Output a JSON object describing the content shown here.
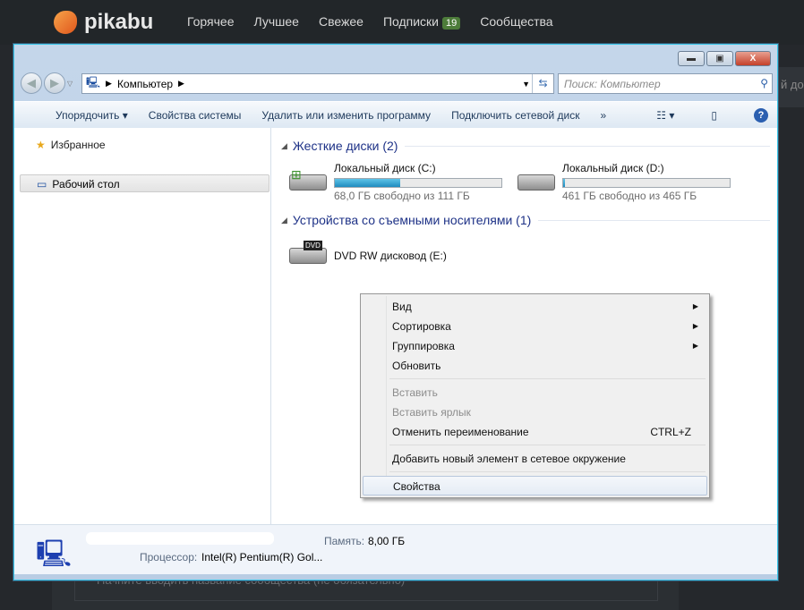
{
  "site": {
    "logo": "pikabu",
    "nav": [
      {
        "label": "Горячее"
      },
      {
        "label": "Лучшее"
      },
      {
        "label": "Свежее"
      },
      {
        "label": "Подписки",
        "badge": "19"
      },
      {
        "label": "Сообщества"
      }
    ],
    "side_text": "й до",
    "community_placeholder": "Начните вводить название сообщества (не обязательно)"
  },
  "explorer": {
    "address": "Компьютер",
    "search_placeholder": "Поиск: Компьютер",
    "toolbar": [
      "Упорядочить",
      "Свойства системы",
      "Удалить или изменить программу",
      "Подключить сетевой диск",
      "»"
    ],
    "sidebar": {
      "favorites": "Избранное",
      "desktop": "Рабочий стол"
    },
    "groups": [
      {
        "title": "Жесткие диски (2)"
      },
      {
        "title": "Устройства со съемными носителями (1)"
      }
    ],
    "drives": [
      {
        "name": "Локальный диск (C:)",
        "free": "68,0 ГБ свободно из 111 ГБ",
        "used_fraction": 0.39
      },
      {
        "name": "Локальный диск (D:)",
        "free": "461 ГБ свободно из 465 ГБ",
        "used_fraction": 0.01
      }
    ],
    "dvd": {
      "name": "DVD RW дисковод (E:)",
      "label": "DVD"
    },
    "details": {
      "memory_label": "Память:",
      "memory": "8,00 ГБ",
      "cpu_label": "Процессор:",
      "cpu": "Intel(R) Pentium(R) Gol..."
    }
  },
  "context_menu": {
    "items": [
      "Вид",
      "Сортировка",
      "Группировка",
      "Обновить",
      "Вставить",
      "Вставить ярлык",
      "Отменить переименование",
      "Добавить новый элемент в сетевое окружение",
      "Свойства"
    ],
    "shortcut": "CTRL+Z"
  }
}
